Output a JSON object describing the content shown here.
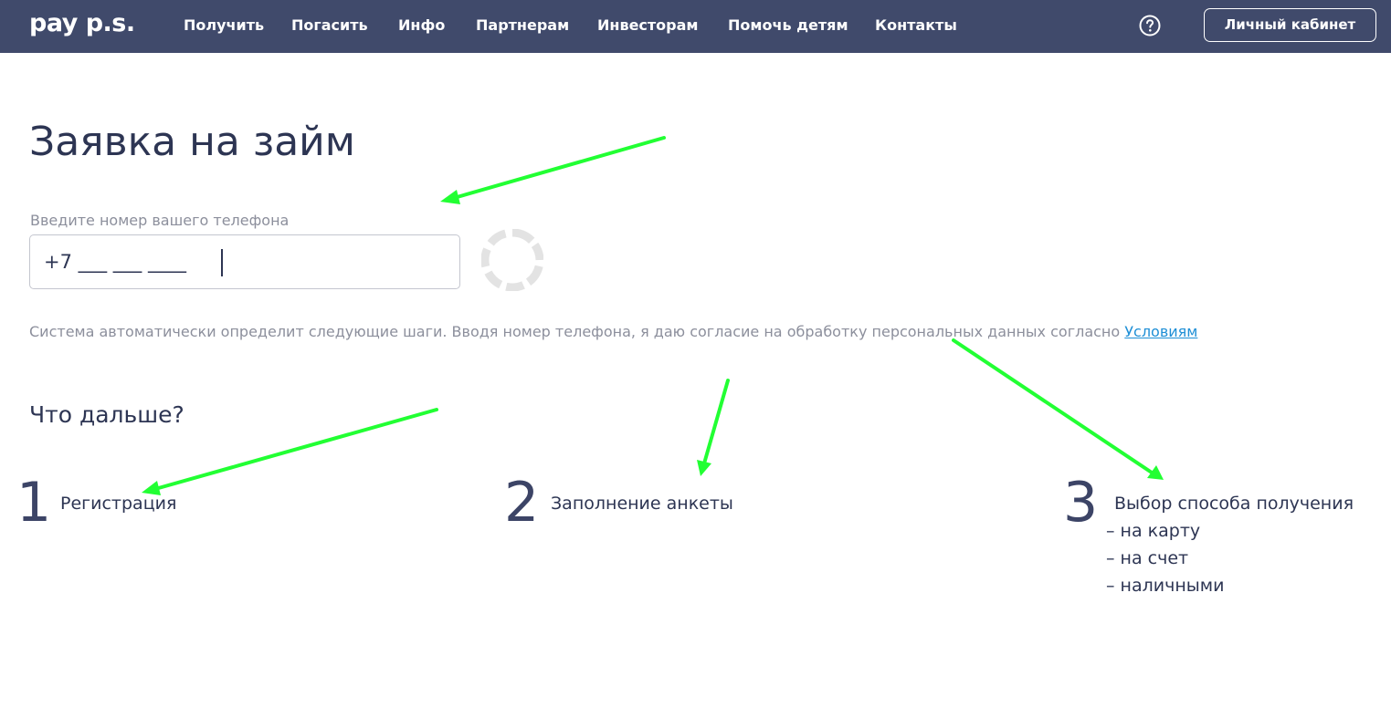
{
  "header": {
    "logo": "pay p.s.",
    "nav": [
      {
        "label": "Получить"
      },
      {
        "label": "Погасить"
      },
      {
        "label": "Инфо"
      },
      {
        "label": "Партнерам"
      },
      {
        "label": "Инвесторам"
      },
      {
        "label": "Помочь детям"
      },
      {
        "label": "Контакты"
      }
    ],
    "help_icon": "question-circle-icon",
    "account_button": "Личный кабинет"
  },
  "main": {
    "title": "Заявка на займ",
    "phone_label": "Введите номер вашего телефона",
    "phone_value": "+7 ___ ___ ____",
    "spinner_icon": "loading-spinner-icon",
    "consent_text": "Система автоматически определит следующие шаги. Вводя номер телефона, я даю согласие на обработку персональных данных согласно ",
    "consent_link": "Условиям",
    "next_heading": "Что дальше?",
    "steps": [
      {
        "number": "1",
        "label": "Регистрация"
      },
      {
        "number": "2",
        "label": "Заполнение анкеты"
      },
      {
        "number": "3",
        "label": "Выбор способа получения",
        "options": [
          "– на карту",
          "– на счет",
          "– наличными"
        ]
      }
    ]
  },
  "colors": {
    "header_bg": "#404a6b",
    "text_dark": "#2d3553",
    "text_muted": "#8c8f9c",
    "link": "#1f8fd6",
    "annotation_arrow": "#22ff33"
  }
}
